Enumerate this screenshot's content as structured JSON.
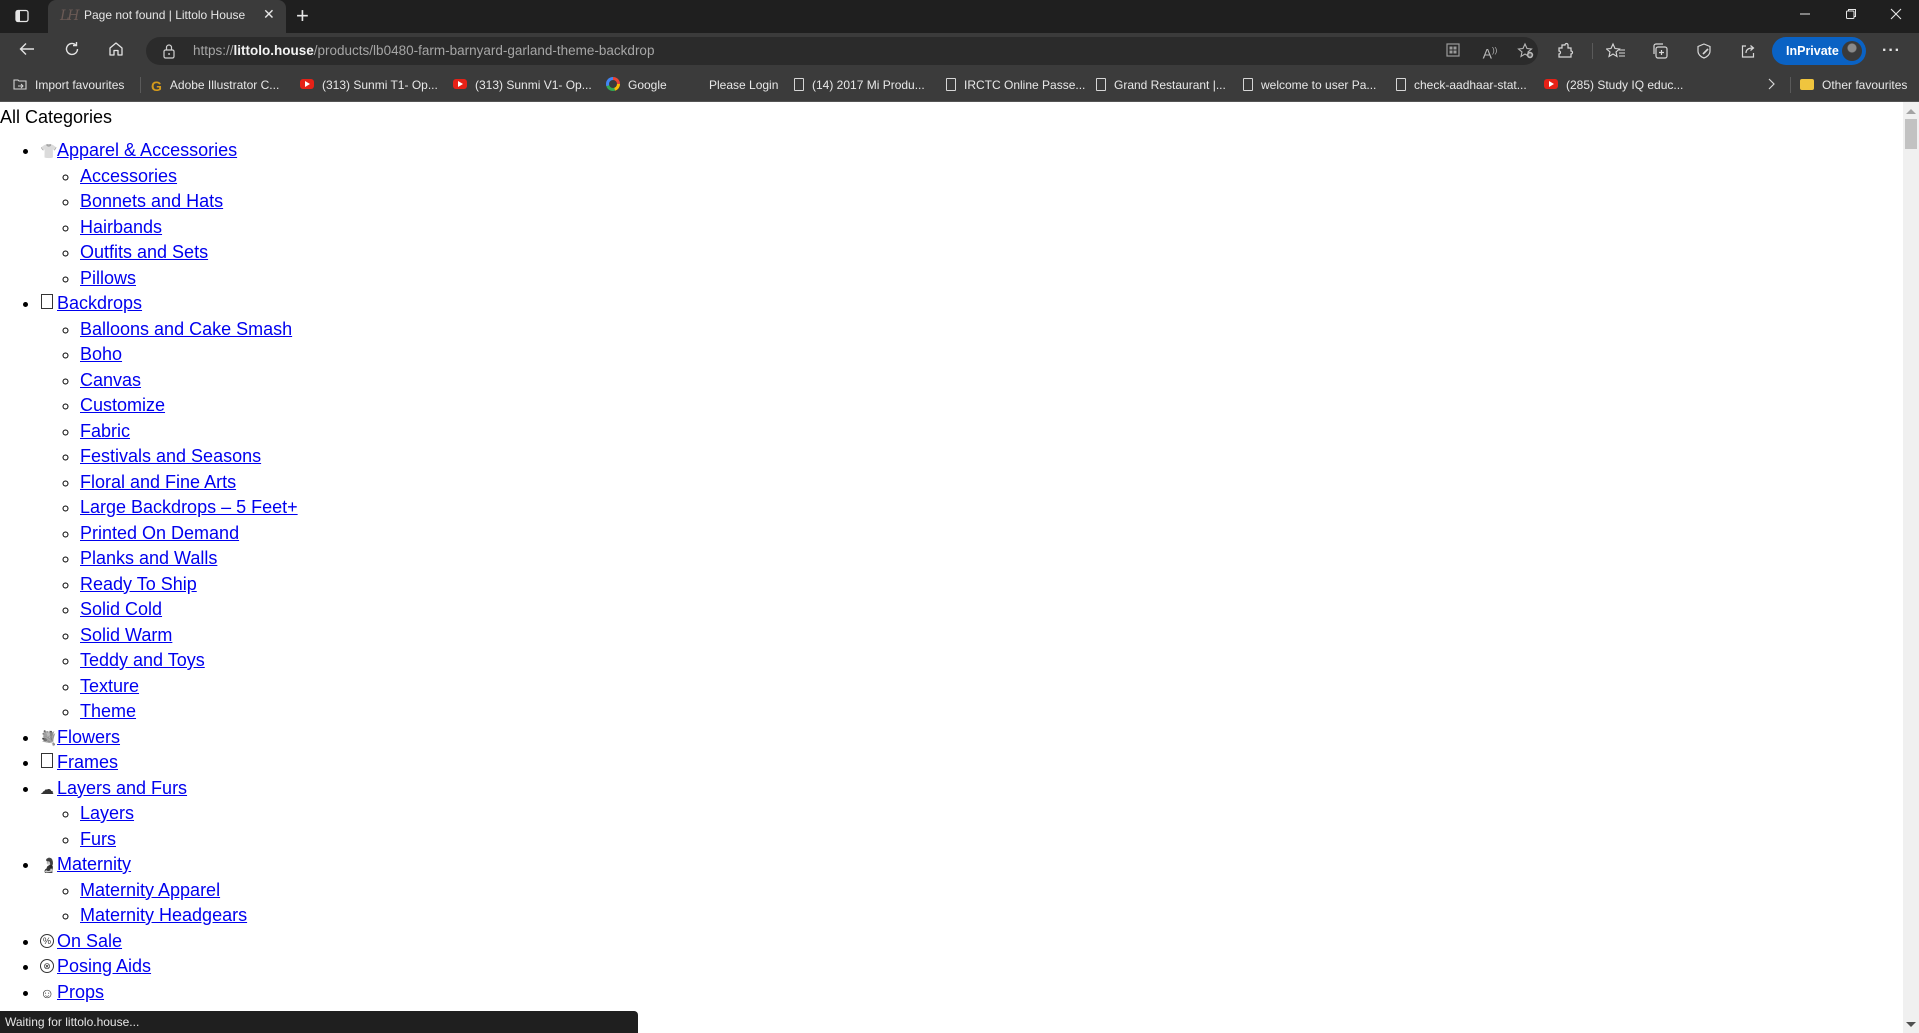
{
  "browser": {
    "tab": {
      "favicon_text": "LH",
      "title": "Page not found | Littolo House"
    },
    "address": {
      "scheme": "https://",
      "host": "littolo.house",
      "path": "/products/lb0480-farm-barnyard-garland-theme-backdrop"
    },
    "inprivate_label": "InPrivate",
    "more_label": "···",
    "icons": {
      "tab_actions": "tab-actions-icon",
      "new_tab": "+",
      "minimize": "—",
      "restore": "❐",
      "close": "✕",
      "back": "←",
      "refresh": "↻",
      "home": "⌂"
    },
    "bookmarks": [
      {
        "label": "Import favourites",
        "icon": "import"
      },
      {
        "label": "Adobe Illustrator C...",
        "icon": "G"
      },
      {
        "label": "(313) Sunmi T1- Op...",
        "icon": "youtube"
      },
      {
        "label": "(313) Sunmi V1- Op...",
        "icon": "youtube"
      },
      {
        "label": "Google",
        "icon": "google"
      },
      {
        "label": "Please Login",
        "icon": "none"
      },
      {
        "label": "(14) 2017 Mi Produ...",
        "icon": "page"
      },
      {
        "label": "IRCTC Online Passe...",
        "icon": "page"
      },
      {
        "label": "Grand Restaurant |...",
        "icon": "page"
      },
      {
        "label": "welcome to user Pa...",
        "icon": "page"
      },
      {
        "label": "check-aadhaar-stat...",
        "icon": "page"
      },
      {
        "label": "(285) Study IQ educ...",
        "icon": "youtube"
      }
    ],
    "other_favourites": "Other favourites",
    "status_text": "Waiting for littolo.house..."
  },
  "page": {
    "heading": "All Categories",
    "categories": [
      {
        "label": "Apparel & Accessories",
        "icon": "apparel",
        "children": [
          "Accessories",
          "Bonnets and Hats",
          "Hairbands",
          "Outfits and Sets",
          "Pillows"
        ]
      },
      {
        "label": "Backdrops",
        "icon": "backdrop",
        "children": [
          "Balloons and Cake Smash",
          "Boho",
          "Canvas",
          "Customize",
          "Fabric",
          "Festivals and Seasons",
          "Floral and Fine Arts",
          "Large Backdrops – 5 Feet+",
          "Printed On Demand",
          "Planks and Walls",
          "Ready To Ship",
          "Solid Cold",
          "Solid Warm",
          "Teddy and Toys",
          "Texture",
          "Theme"
        ]
      },
      {
        "label": "Flowers",
        "icon": "flowers",
        "children": []
      },
      {
        "label": "Frames",
        "icon": "frame",
        "children": []
      },
      {
        "label": "Layers and Furs",
        "icon": "layers",
        "children": [
          "Layers",
          "Furs"
        ]
      },
      {
        "label": "Maternity",
        "icon": "maternity",
        "children": [
          "Maternity Apparel",
          "Maternity Headgears"
        ]
      },
      {
        "label": "On Sale",
        "icon": "sale",
        "children": []
      },
      {
        "label": "Posing Aids",
        "icon": "posing",
        "children": []
      },
      {
        "label": "Props",
        "icon": "props",
        "children": []
      }
    ]
  }
}
